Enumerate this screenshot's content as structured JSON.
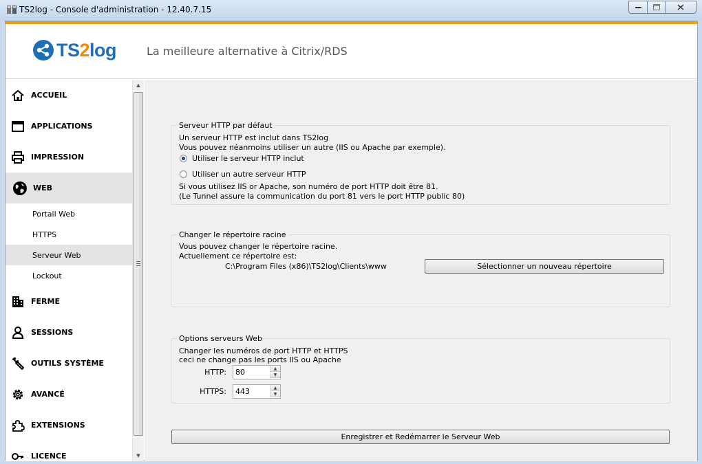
{
  "window": {
    "title": "TS2log - Console d'administration - 12.40.7.15"
  },
  "header": {
    "logo_ts": "TS",
    "logo_two": "2",
    "logo_log": "log",
    "tagline": "La meilleure alternative à Citrix/RDS"
  },
  "sidebar": {
    "items": [
      {
        "label": "ACCUEIL",
        "icon": "home-icon"
      },
      {
        "label": "APPLICATIONS",
        "icon": "window-icon"
      },
      {
        "label": "IMPRESSION",
        "icon": "printer-icon"
      },
      {
        "label": "WEB",
        "icon": "globe-icon"
      },
      {
        "label": "FERME",
        "icon": "building-icon"
      },
      {
        "label": "SESSIONS",
        "icon": "user-icon"
      },
      {
        "label": "OUTILS SYSTÈME",
        "icon": "wrench-icon"
      },
      {
        "label": "AVANCÉ",
        "icon": "gear-icon"
      },
      {
        "label": "EXTENSIONS",
        "icon": "puzzle-icon"
      },
      {
        "label": "LICENCE",
        "icon": "key-icon"
      }
    ],
    "web_subitems": [
      "Portail Web",
      "HTTPS",
      "Serveur Web",
      "Lockout"
    ],
    "active_item": "WEB",
    "active_subitem": "Serveur Web"
  },
  "http_server": {
    "title": "Serveur HTTP par défaut",
    "line1": "Un serveur HTTP est inclut dans TS2log",
    "line2": "Vous pouvez néanmoins utiliser un autre (IIS ou Apache par exemple).",
    "option_builtin": "Utiliser le serveur HTTP inclut",
    "option_other": "Utiliser un autre serveur HTTP",
    "selected": "builtin",
    "note1": "Si vous utilisez IIS or Apache, son numéro de port HTTP doit être 81.",
    "note2": "(Le Tunnel assure la communication du port 81 vers le port HTTP public 80)"
  },
  "root_dir": {
    "title": "Changer le répertoire racine",
    "line1": "Vous pouvez changer le répertoire racine.",
    "line2": "Actuellement ce répertoire est:",
    "path": "C:\\Program Files (x86)\\TS2log\\Clients\\www",
    "select_button": "Sélectionner un nouveau répertoire"
  },
  "web_options": {
    "title": "Options serveurs Web",
    "line1": "Changer les numéros de port HTTP et HTTPS",
    "line2": "ceci ne change pas les ports IIS ou Apache",
    "http_label": "HTTP:",
    "http_value": "80",
    "https_label": "HTTPS:",
    "https_value": "443"
  },
  "save_button": "Enregistrer et Redémarrer le Serveur Web",
  "colors": {
    "accent_orange": "#f5a000",
    "logo_blue": "#1e6fb6",
    "active_bg": "#e4e4e4"
  }
}
